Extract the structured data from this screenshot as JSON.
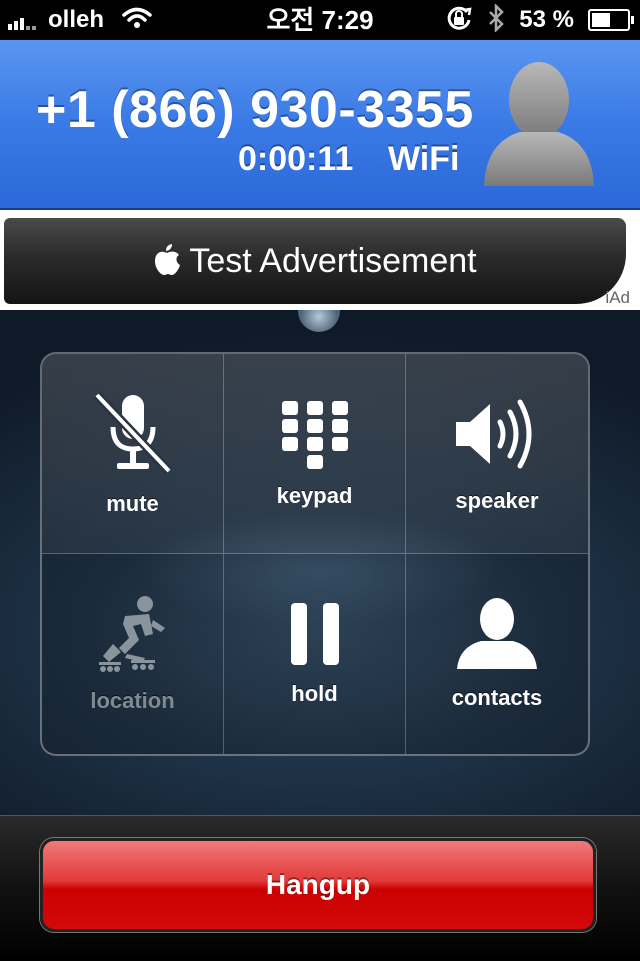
{
  "status_bar": {
    "carrier": "olleh",
    "time": "오전 7:29",
    "battery_percent": "53 %",
    "battery_level": 0.53,
    "icons": [
      "signal-icon",
      "wifi-icon",
      "orientation-lock-icon",
      "bluetooth-icon",
      "battery-icon"
    ]
  },
  "call": {
    "number": "+1 (866) 930-3355",
    "duration": "0:00:11",
    "network": "WiFi",
    "header_color": "#3a7ae6"
  },
  "ad": {
    "text": "Test Advertisement",
    "badge": "iAd",
    "icon": "apple-icon"
  },
  "controls": [
    {
      "label": "mute",
      "icon": "muted-microphone-icon",
      "enabled": true
    },
    {
      "label": "keypad",
      "icon": "keypad-icon",
      "enabled": true
    },
    {
      "label": "speaker",
      "icon": "speaker-icon",
      "enabled": true
    },
    {
      "label": "location",
      "icon": "skater-icon",
      "enabled": false
    },
    {
      "label": "hold",
      "icon": "pause-icon",
      "enabled": true
    },
    {
      "label": "contacts",
      "icon": "person-icon",
      "enabled": true
    }
  ],
  "hangup": {
    "label": "Hangup",
    "color": "#d30a0a"
  }
}
